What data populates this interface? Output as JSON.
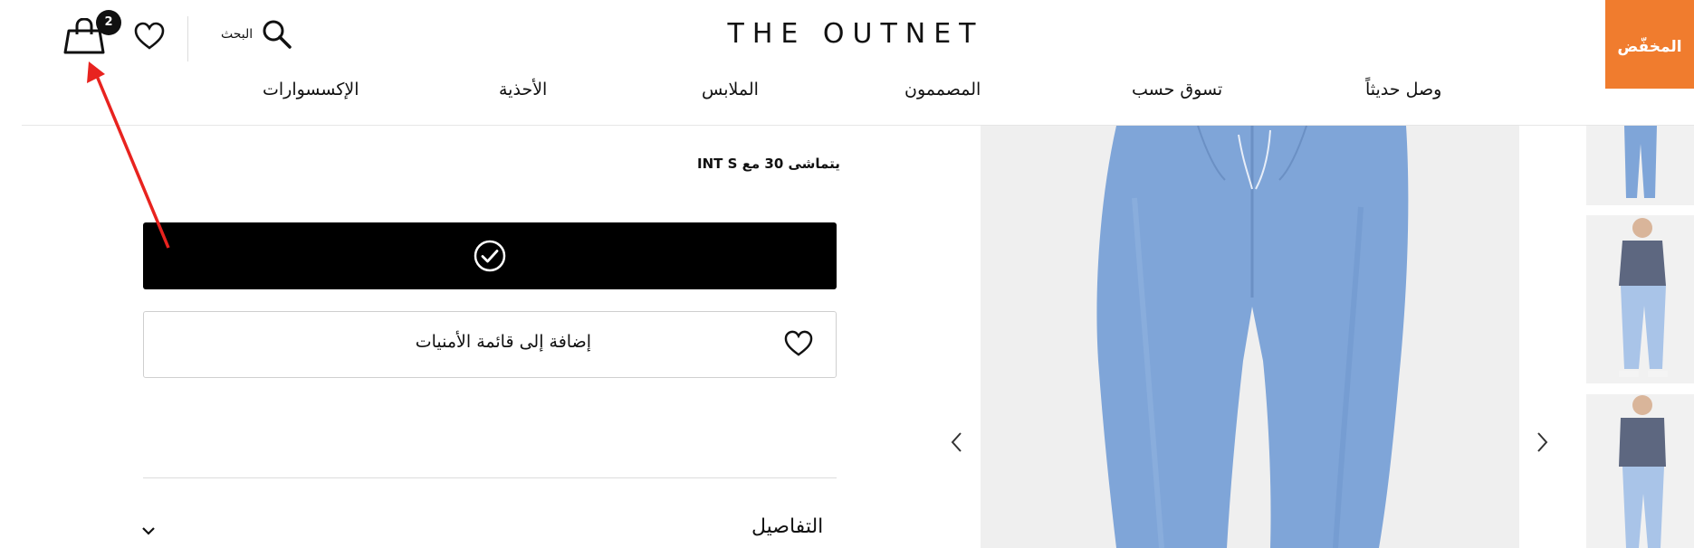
{
  "header": {
    "brand_badge": "المخفّض",
    "logo": "THE OUTNET",
    "search_label": "البحث",
    "bag_count": "2",
    "nav_items": [
      "وصل حديثاً",
      "تسوق حسب",
      "المصممون",
      "الملابس",
      "الأحذية",
      "الإكسسوارات"
    ]
  },
  "product": {
    "fit_note": "يتماشى 30 مع INT S",
    "wishlist_label": "إضافة إلى قائمة الأمنيات",
    "details_label": "التفاصيل"
  },
  "colors": {
    "brand_badge": "#f07c2e",
    "denim": "#7fa5d8",
    "annotation": "#e8231f"
  }
}
